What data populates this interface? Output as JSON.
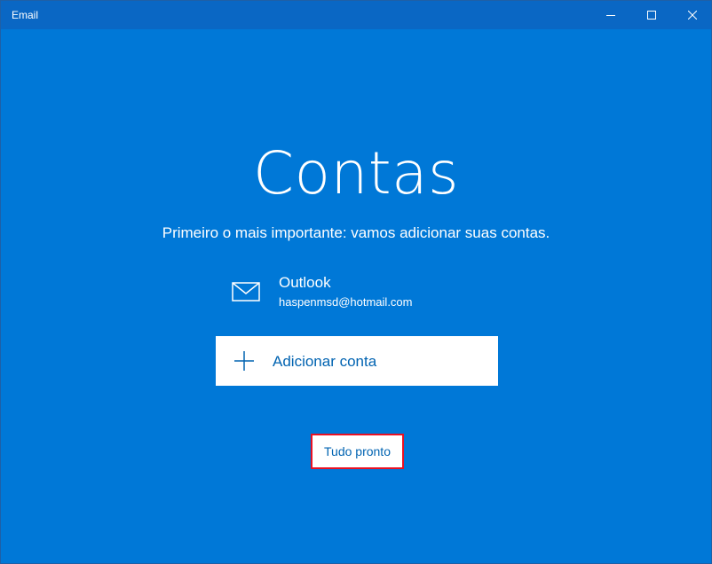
{
  "window": {
    "title": "Email",
    "controls": [
      "minimize-icon",
      "maximize-icon",
      "close-icon"
    ]
  },
  "main": {
    "heading": "Contas",
    "subtitle": "Primeiro o mais importante: vamos adicionar suas contas.",
    "account": {
      "icon": "mail-icon",
      "name": "Outlook",
      "email": "haspenmsd@hotmail.com"
    },
    "add_account": {
      "icon": "plus-icon",
      "label": "Adicionar conta"
    },
    "done": {
      "label": "Tudo pronto"
    }
  },
  "colors": {
    "background": "#0078d7",
    "titlebar": "#0a67c4",
    "link_text": "#0063b1",
    "highlight_border": "#e81123"
  }
}
